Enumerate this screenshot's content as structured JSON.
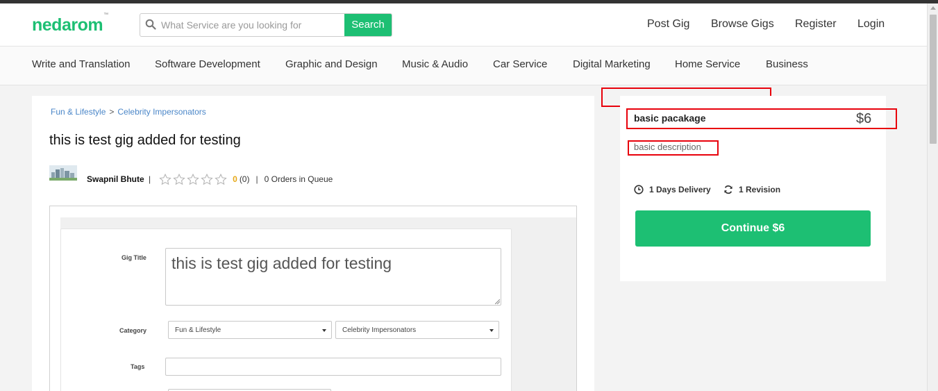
{
  "brand": {
    "logo": "nedarom",
    "trademark": "™",
    "accent": "#1dbf73"
  },
  "search": {
    "placeholder": "What Service are you looking for",
    "button_label": "Search"
  },
  "top_nav": {
    "post_gig": "Post Gig",
    "browse_gigs": "Browse Gigs",
    "register": "Register",
    "login": "Login"
  },
  "categories": [
    "Write and Translation",
    "Software Development",
    "Graphic and Design",
    "Music & Audio",
    "Car Service",
    "Digital Marketing",
    "Home Service",
    "Business"
  ],
  "breadcrumb": {
    "parent": "Fun & Lifestyle",
    "separator": ">",
    "child": "Celebrity Impersonators"
  },
  "gig": {
    "title": "this is test gig added for testing",
    "seller": "Swapnil Bhute",
    "rating_stars_filled": 0,
    "rating_value": "0",
    "rating_count": "(0)",
    "orders_queue": "0 Orders in Queue"
  },
  "form": {
    "gig_title_label": "Gig Title",
    "gig_title_value": "this is test gig added for testing",
    "category_label": "Category",
    "category_value": "Fun & Lifestyle",
    "subcategory_value": "Celebrity Impersonators",
    "tags_label": "Tags",
    "tags_value": ""
  },
  "package": {
    "name": "basic pacakage",
    "price": "$6",
    "description": "basic description",
    "delivery": "1 Days Delivery",
    "revision": "1 Revision",
    "continue_label": "Continue $6",
    "highlight_color": "#e8000b"
  }
}
